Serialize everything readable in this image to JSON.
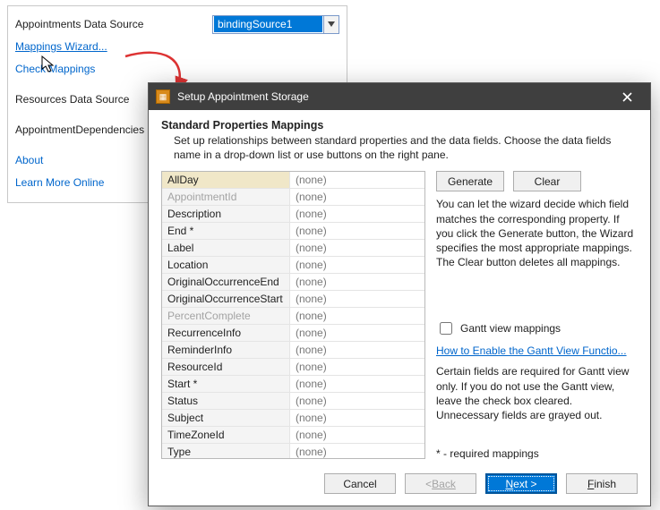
{
  "panel": {
    "appointments_label": "Appointments  Data Source",
    "appointments_value": "bindingSource1",
    "mappings_wizard": "Mappings Wizard...",
    "check_mappings": "Check Mappings",
    "resources_label": "Resources  Data Source",
    "dependencies_label": "AppointmentDependencies",
    "about": "About",
    "learn_more": "Learn More Online"
  },
  "wizard": {
    "title": "Setup Appointment Storage",
    "heading": "Standard Properties Mappings",
    "subheading": "Set up relationships between standard properties and the data fields. Choose the data fields name in a drop-down list or use buttons on the right pane.",
    "buttons": {
      "generate": "Generate",
      "clear": "Clear",
      "cancel": "Cancel",
      "back": "Back",
      "next": "Next >",
      "finish": "Finish"
    },
    "desc": "You can let the wizard decide which field matches the corresponding property. If you click the Generate button, the Wizard specifies the most appropriate mappings. The Clear button deletes all mappings.",
    "gantt_checkbox": "Gantt view mappings",
    "gantt_link": "How to  Enable the Gantt View Functio...",
    "gantt_desc": "Certain fields are required for Gantt view only. If you do not use the Gantt view, leave the check box cleared. Unnecessary fields are grayed out.",
    "required_note": "* - required mappings",
    "props": [
      {
        "name": "AllDay",
        "value": "(none)",
        "sel": true
      },
      {
        "name": "AppointmentId",
        "value": "(none)",
        "disabled": true
      },
      {
        "name": "Description",
        "value": "(none)"
      },
      {
        "name": "End *",
        "value": "(none)"
      },
      {
        "name": "Label",
        "value": "(none)"
      },
      {
        "name": "Location",
        "value": "(none)"
      },
      {
        "name": "OriginalOccurrenceEnd",
        "value": "(none)"
      },
      {
        "name": "OriginalOccurrenceStart",
        "value": "(none)"
      },
      {
        "name": "PercentComplete",
        "value": "(none)",
        "disabled": true
      },
      {
        "name": "RecurrenceInfo",
        "value": "(none)"
      },
      {
        "name": "ReminderInfo",
        "value": "(none)"
      },
      {
        "name": "ResourceId",
        "value": "(none)"
      },
      {
        "name": "Start *",
        "value": "(none)"
      },
      {
        "name": "Status",
        "value": "(none)"
      },
      {
        "name": "Subject",
        "value": "(none)"
      },
      {
        "name": "TimeZoneId",
        "value": "(none)"
      },
      {
        "name": "Type",
        "value": "(none)"
      }
    ]
  }
}
